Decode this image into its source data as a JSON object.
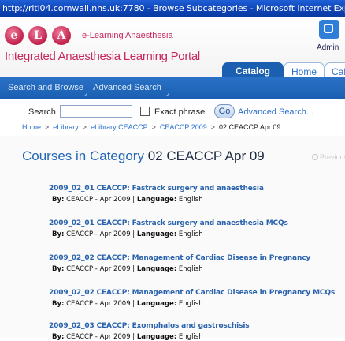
{
  "window": {
    "title": "http://riti04.cornwall.nhs.uk:7780 - Browse Subcategories - Microsoft Internet Explorer"
  },
  "header": {
    "logo_letters": [
      "e",
      "L",
      "A"
    ],
    "logo_text": "e-Learning Anaesthesia",
    "portal_title": "Integrated Anaesthesia Learning Portal",
    "admin_label": "Admin",
    "tabs": [
      {
        "label": "Catalog",
        "active": true
      },
      {
        "label": "Home",
        "active": false
      },
      {
        "label": "Cal",
        "active": false
      }
    ]
  },
  "nav": {
    "items": [
      "Search and Browse",
      "Advanced Search"
    ]
  },
  "search": {
    "label": "Search",
    "value": "",
    "exact_phrase_label": "Exact phrase",
    "go_label": "Go",
    "advanced_link": "Advanced Search..."
  },
  "breadcrumb": {
    "items": [
      "Home",
      "eLibrary",
      "eLibrary CEACCP",
      "CEACCP 2009"
    ],
    "separator": ">",
    "current": "02 CEACCP Apr 09"
  },
  "content": {
    "title_prefix": "Courses in Category",
    "title_category": "02 CEACCP Apr 09",
    "previous_label": "Previous",
    "by_label": "By:",
    "language_label": "Language:",
    "courses": [
      {
        "title": "2009_02_01 CEACCP: Fastrack surgery and anaesthesia",
        "by": "CEACCP - Apr 2009",
        "language": "English"
      },
      {
        "title": "2009_02_01 CEACCP: Fastrack surgery and anaesthesia MCQs",
        "by": "CEACCP - Apr 2009",
        "language": "English"
      },
      {
        "title": "2009_02_02 CEACCP: Management of Cardiac Disease in Pregnancy",
        "by": "CEACCP - Apr 2009",
        "language": "English"
      },
      {
        "title": "2009_02_02 CEACCP: Management of Cardiac Disease in Pregnancy MCQs",
        "by": "CEACCP - Apr 2009",
        "language": "English"
      },
      {
        "title": "2009_02_03 CEACCP: Exomphalos and gastroschisis",
        "by": "CEACCP - Apr 2009",
        "language": "English"
      }
    ]
  },
  "colors": {
    "brand_pink": "#c8285a",
    "nav_blue": "#1a5fb0",
    "link_blue": "#2a63ad"
  }
}
